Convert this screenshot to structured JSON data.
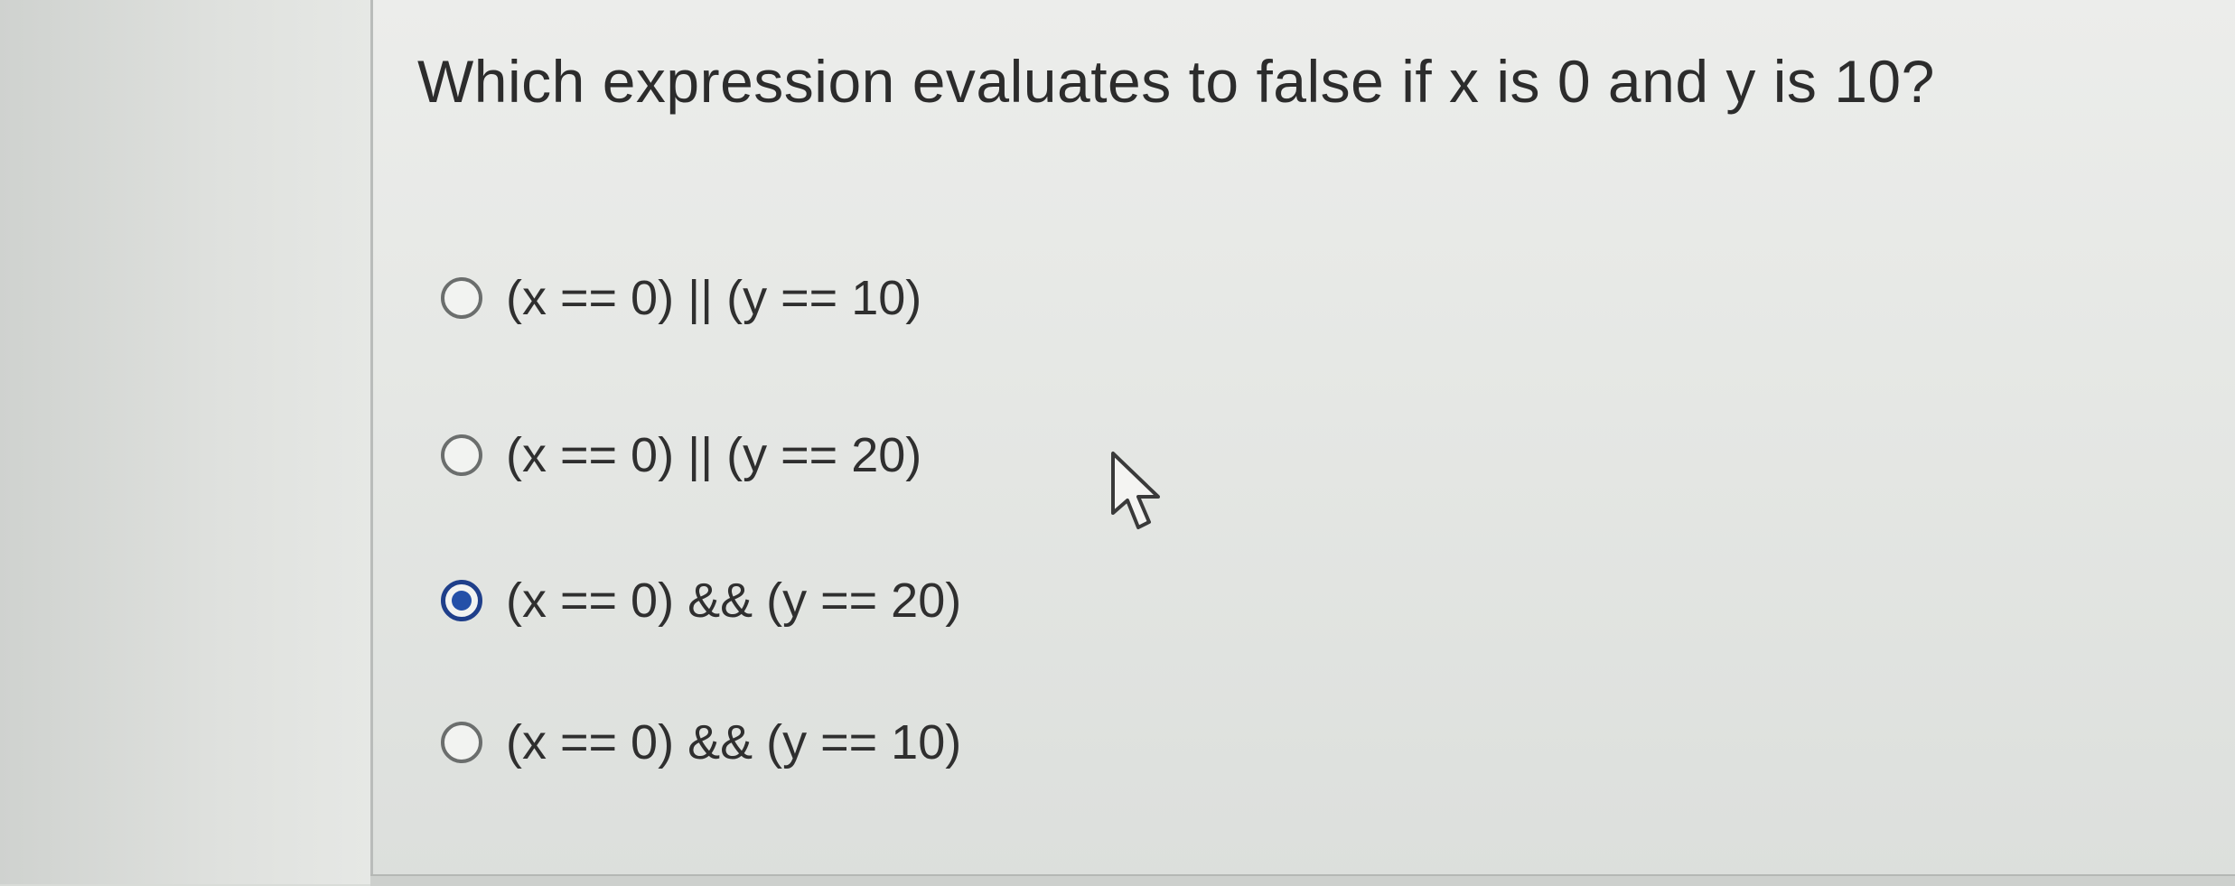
{
  "question": {
    "text": "Which expression evaluates to false if x is 0 and y is 10?"
  },
  "options": [
    {
      "label": "(x == 0) || (y == 10)",
      "selected": false
    },
    {
      "label": "(x == 0) || (y == 20)",
      "selected": false
    },
    {
      "label": "(x == 0) && (y == 20)",
      "selected": true
    },
    {
      "label": "(x == 0) && (y == 10)",
      "selected": false
    }
  ],
  "colors": {
    "selected_radio": "#2450a8",
    "text": "#2c2c2c"
  },
  "icons": {
    "cursor": "pointer-cursor-icon"
  }
}
